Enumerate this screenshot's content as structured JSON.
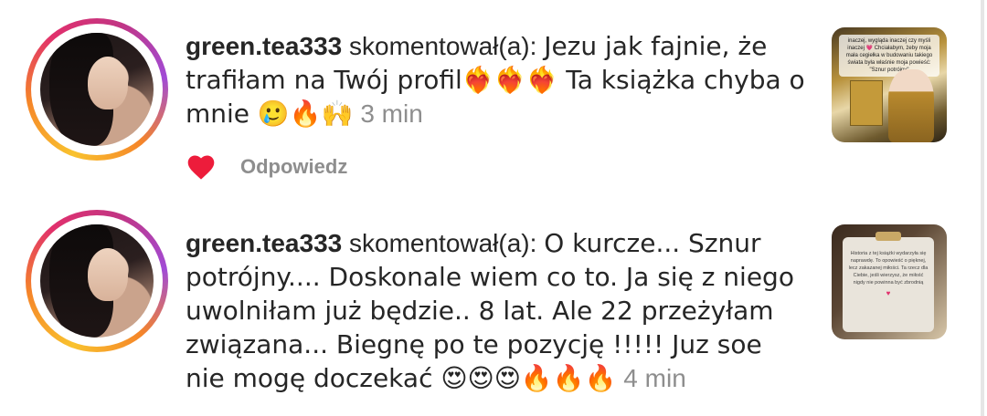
{
  "comments": [
    {
      "username": "green.tea333",
      "action": " skomentował(a): ",
      "text": "Jezu jak fajnie, że trafiłam na Twój profil❤️‍🔥❤️‍🔥❤️‍🔥 Ta książka chyba o mnie 🥲🔥🙌",
      "time": "3 min",
      "liked": true,
      "reply_label": "Odpowiedz",
      "thumbnail_text": "inaczej, wygląda inaczej czy myśli inaczej 💗 Chciałabym, żeby moja mała cegiełka w budowaniu takiego świata była właśnie moja powieść: \"Sznur potrójny\""
    },
    {
      "username": "green.tea333",
      "action": " skomentował(a): ",
      "text": "O kurcze... Sznur potrójny.... Doskonale wiem co to. Ja się z niego uwolniłam już będzie.. 8 lat. Ale 22 przeżyłam związana... Biegnę po te pozycję !!!!! Juz soe nie mogę doczekać 😍😍😍🔥🔥🔥",
      "time": "4 min",
      "thumbnail_text": "Historia z tej książki wydarzyła się naprawdę. To opowieść o pięknej, lecz zakazanej miłości. Ta rzecz dla Ciebie, jeśli wierzysz, że miłość nigdy nie powinna być zbrodnią"
    }
  ],
  "colors": {
    "heart": "#ed1c3b",
    "secondary_text": "#8e8e8e",
    "primary_text": "#262626"
  },
  "icons": [
    "heart-icon"
  ]
}
